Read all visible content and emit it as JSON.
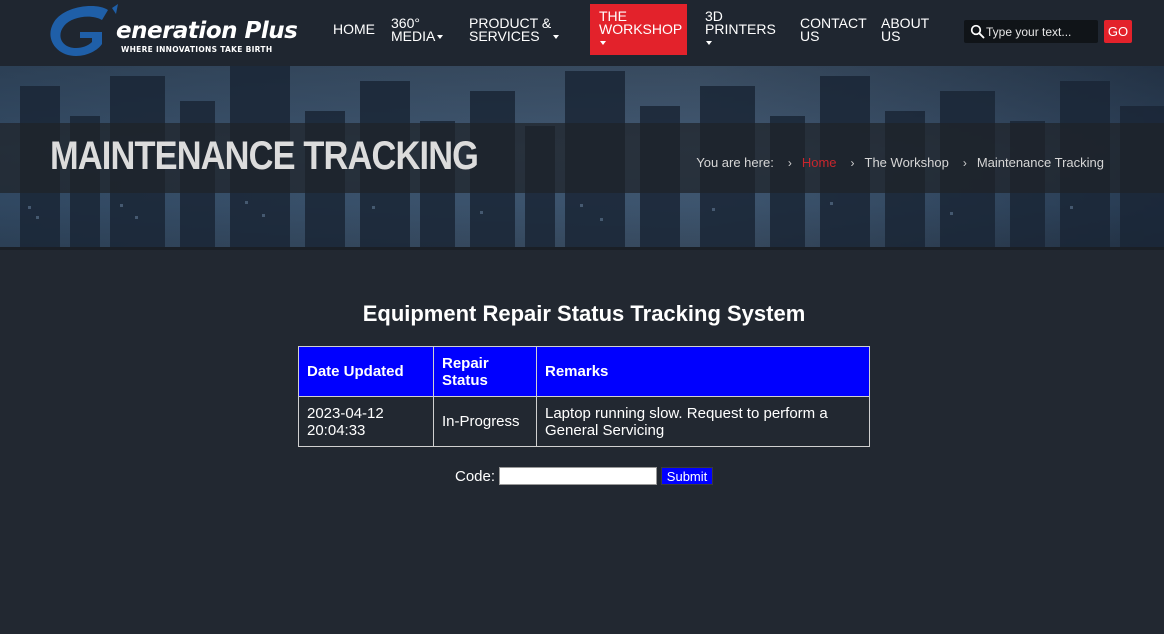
{
  "brand": {
    "name": "eneration Plus",
    "tagline": "WHERE INNOVATIONS TAKE BIRTH",
    "accent_color": "#e3222b",
    "logo_blue": "#1f5fa8"
  },
  "nav": {
    "items": [
      {
        "label": "HOME",
        "has_dropdown": false
      },
      {
        "label": "360°\nMEDIA",
        "has_dropdown": true
      },
      {
        "label": "PRODUCT &\nSERVICES",
        "has_dropdown": true
      },
      {
        "label": "THE\nWORKSHOP",
        "has_dropdown": true,
        "active": true
      },
      {
        "label": "3D\nPRINTERS",
        "has_dropdown": true
      },
      {
        "label": "CONTACT\nUS",
        "has_dropdown": false
      },
      {
        "label": "ABOUT\nUS",
        "has_dropdown": false
      }
    ]
  },
  "search": {
    "placeholder": "Type your text...",
    "button_label": "GO",
    "icon": "search-icon"
  },
  "banner": {
    "title": "MAINTENANCE TRACKING",
    "breadcrumb": {
      "prefix": "You are here:",
      "items": [
        "Home",
        "The Workshop",
        "Maintenance Tracking"
      ]
    }
  },
  "main": {
    "heading": "Equipment Repair Status Tracking System",
    "table": {
      "header_color": "#0000ff",
      "columns": [
        "Date Updated",
        "Repair\nStatus",
        "Remarks"
      ],
      "rows": [
        [
          "2023-04-12\n20:04:33",
          "In-Progress",
          "Laptop running slow. Request to perform a\nGeneral Servicing"
        ]
      ]
    },
    "code_form": {
      "label": "Code:",
      "value": "",
      "submit_label": "Submit"
    }
  }
}
